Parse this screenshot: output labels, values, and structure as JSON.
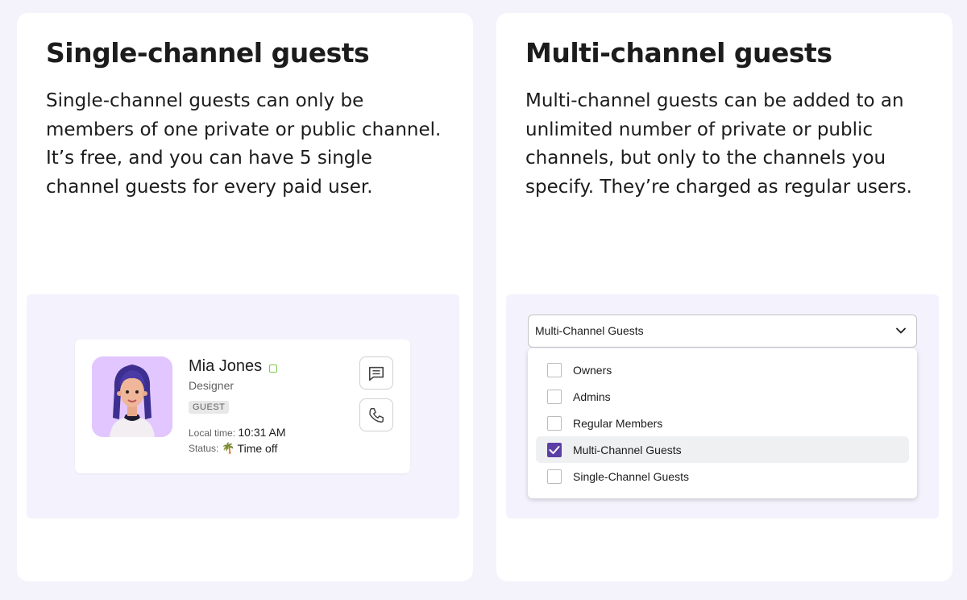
{
  "left_panel": {
    "title": "Single-channel guests",
    "description": "Single-channel guests can only be members of one private or public channel. It’s free, and you can have 5 single channel guests for every paid user.",
    "profile": {
      "name": "Mia Jones",
      "role": "Designer",
      "badge": "GUEST",
      "local_time_label": "Local time:",
      "local_time_value": "10:31 AM",
      "status_label": "Status:",
      "status_emoji": "🌴",
      "status_value": "Time off",
      "presence_color": "#7bc74a",
      "avatar_bg": "#e2c6ff",
      "message_icon": "message-icon",
      "call_icon": "phone-icon"
    }
  },
  "right_panel": {
    "title": "Multi-channel guests",
    "description": "Multi-channel guests can be added to an unlimited number of private or public channels, but only to the channels you specify. They’re charged as regular users.",
    "dropdown": {
      "selected_value": "Multi-Channel Guests",
      "options": [
        {
          "label": "Owners",
          "checked": false
        },
        {
          "label": "Admins",
          "checked": false
        },
        {
          "label": "Regular Members",
          "checked": false
        },
        {
          "label": "Multi-Channel Guests",
          "checked": true
        },
        {
          "label": "Single-Channel Guests",
          "checked": false
        }
      ],
      "check_color": "#5b3fa4"
    }
  }
}
